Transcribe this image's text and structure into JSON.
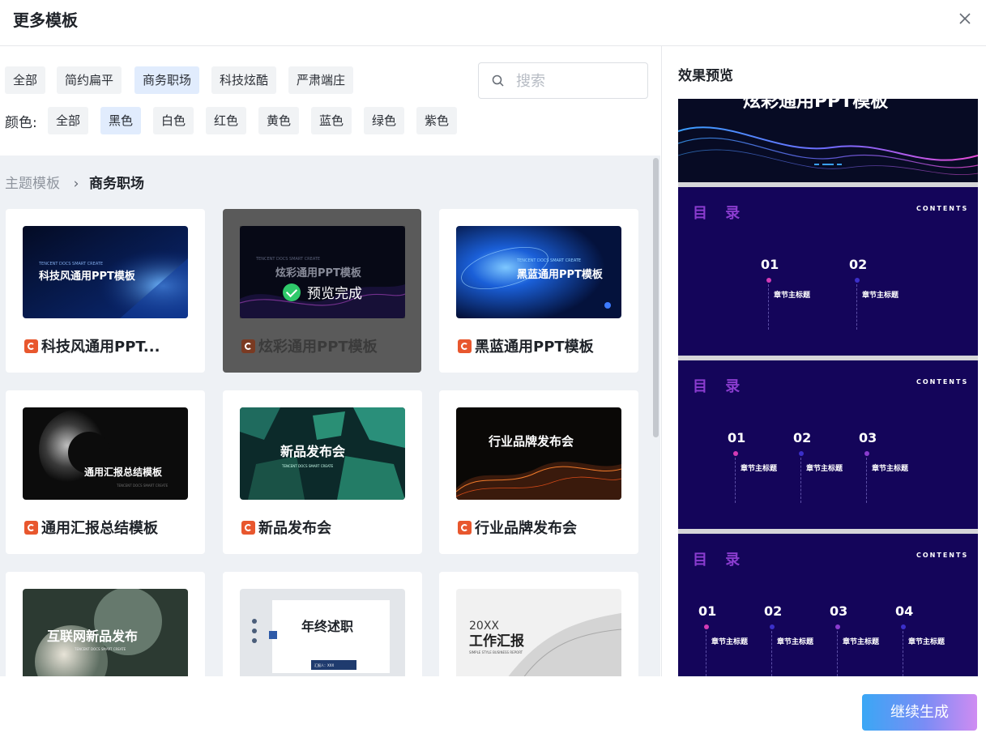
{
  "dialog": {
    "title": "更多模板"
  },
  "filters": {
    "styles": [
      "全部",
      "简约扁平",
      "商务职场",
      "科技炫酷",
      "严肃端庄"
    ],
    "active_style": "商务职场",
    "color_label": "颜色:",
    "colors": [
      "全部",
      "黑色",
      "白色",
      "红色",
      "黄色",
      "蓝色",
      "绿色",
      "紫色"
    ],
    "active_color": "黑色"
  },
  "search": {
    "placeholder": "搜索",
    "value": ""
  },
  "breadcrumb": {
    "parent": "主题模板",
    "current": "商务职场"
  },
  "templates": [
    {
      "name": "科技风通用PPT...",
      "thumb_text": "科技风通用PPT模板",
      "thumb_sub": "TENCENT DOCS SMART CREATE",
      "selected": false
    },
    {
      "name": "炫彩通用PPT模板",
      "thumb_text": "炫彩通用PPT模板",
      "thumb_sub": "TENCENT DOCS SMART CREATE",
      "selected": true,
      "status": "预览完成"
    },
    {
      "name": "黑蓝通用PPT模板",
      "thumb_text": "黑蓝通用PPT模板",
      "thumb_sub": "TENCENT DOCS SMART CREATE",
      "selected": false
    },
    {
      "name": "通用汇报总结模板",
      "thumb_text": "通用汇报总结模板",
      "thumb_sub": "TENCENT DOCS SMART CREATE",
      "selected": false
    },
    {
      "name": "新品发布会",
      "thumb_text": "新品发布会",
      "thumb_sub": "TENCENT DOCS SMART CREATE",
      "selected": false
    },
    {
      "name": "行业品牌发布会",
      "thumb_text": "行业品牌发布会",
      "thumb_sub": "",
      "selected": false
    },
    {
      "name": "",
      "thumb_text": "互联网新品发布",
      "thumb_sub": "TENCENT DOCS SMART CREATE",
      "selected": false
    },
    {
      "name": "",
      "thumb_text": "年终述职",
      "thumb_sub": "汇报人：XXX",
      "selected": false
    },
    {
      "name": "",
      "thumb_text": "工作汇报",
      "thumb_year": "20XX",
      "thumb_sub": "SIMPLE STYLE BUSINESS REPORT",
      "selected": false
    }
  ],
  "preview": {
    "title": "效果预览",
    "cover_text": "炫彩通用PPT模板",
    "toc_title": "目 录",
    "toc_contents": "CONTENTS",
    "toc_slides": [
      {
        "items": [
          {
            "num": "01",
            "label": "章节主标题"
          },
          {
            "num": "02",
            "label": "章节主标题"
          }
        ]
      },
      {
        "items": [
          {
            "num": "01",
            "label": "章节主标题"
          },
          {
            "num": "02",
            "label": "章节主标题"
          },
          {
            "num": "03",
            "label": "章节主标题"
          }
        ]
      },
      {
        "items": [
          {
            "num": "01",
            "label": "章节主标题"
          },
          {
            "num": "02",
            "label": "章节主标题"
          },
          {
            "num": "03",
            "label": "章节主标题"
          },
          {
            "num": "04",
            "label": "章节主标题"
          }
        ]
      }
    ]
  },
  "footer": {
    "continue_label": "继续生成"
  },
  "colors": {
    "accent_active": "#e1ecfd",
    "chip_bg": "#f1f3f5",
    "toc_bg": "#14055a",
    "check_green": "#2fc96a"
  }
}
